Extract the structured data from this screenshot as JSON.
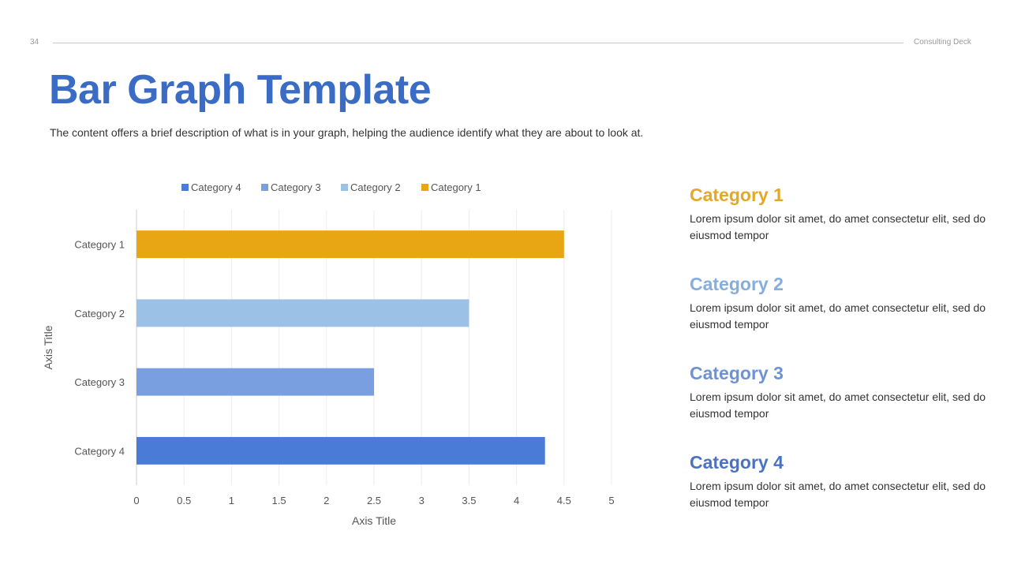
{
  "header": {
    "page_number": "34",
    "deck_name": "Consulting Deck"
  },
  "title": "Bar Graph Template",
  "subtitle": "The content offers a brief description of what is in your graph, helping the audience identify what they are about to look at.",
  "chart_data": {
    "type": "bar",
    "orientation": "horizontal",
    "categories": [
      "Category 1",
      "Category 2",
      "Category 3",
      "Category 4"
    ],
    "values": [
      4.5,
      3.5,
      2.5,
      4.3
    ],
    "colors": [
      "#E8A614",
      "#9BC2E6",
      "#7A9FE0",
      "#4A7BD6"
    ],
    "legend": [
      {
        "label": "Category 4",
        "color": "#4A7BD6"
      },
      {
        "label": "Category 3",
        "color": "#7A9FE0"
      },
      {
        "label": "Category 2",
        "color": "#9BC2E6"
      },
      {
        "label": "Category 1",
        "color": "#E8A614"
      }
    ],
    "legend_position": "top",
    "xlabel": "Axis Title",
    "ylabel": "Axis Title",
    "xlim": [
      0,
      5
    ],
    "xticks": [
      "0",
      "0.5",
      "1",
      "1.5",
      "2",
      "2.5",
      "3",
      "3.5",
      "4",
      "4.5",
      "5"
    ],
    "grid": true
  },
  "side_panel": [
    {
      "heading": "Category 1",
      "color": "#E3A827",
      "text": "Lorem ipsum dolor sit amet, do amet consectetur elit, sed do eiusmod tempor"
    },
    {
      "heading": "Category 2",
      "color": "#86ADDB",
      "text": "Lorem ipsum dolor sit amet, do amet consectetur elit, sed do eiusmod tempor"
    },
    {
      "heading": "Category 3",
      "color": "#6E93D4",
      "text": "Lorem ipsum dolor sit amet, do amet consectetur elit, sed do eiusmod tempor"
    },
    {
      "heading": "Category 4",
      "color": "#4B72C2",
      "text": "Lorem ipsum dolor sit amet, do amet consectetur elit, sed do eiusmod tempor"
    }
  ]
}
